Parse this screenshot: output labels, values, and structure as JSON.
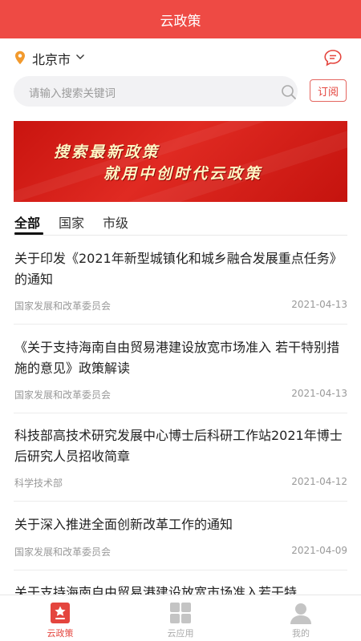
{
  "header": {
    "title": "云政策"
  },
  "location": {
    "city": "北京市"
  },
  "search": {
    "placeholder": "请输入搜索关键词",
    "subscribe_label": "订阅"
  },
  "banner": {
    "line1": "搜索最新政策",
    "line2": "就用中创时代云政策"
  },
  "tabs": [
    {
      "label": "全部",
      "active": true
    },
    {
      "label": "国家",
      "active": false
    },
    {
      "label": "市级",
      "active": false
    }
  ],
  "news": [
    {
      "title": "关于印发《2021年新型城镇化和城乡融合发展重点任务》的通知",
      "source": "国家发展和改革委员会",
      "date": "2021-04-13"
    },
    {
      "title": "《关于支持海南自由贸易港建设放宽市场准入 若干特别措施的意见》政策解读",
      "source": "国家发展和改革委员会",
      "date": "2021-04-13"
    },
    {
      "title": "科技部高技术研究发展中心博士后科研工作站2021年博士后研究人员招收简章",
      "source": "科学技术部",
      "date": "2021-04-12"
    },
    {
      "title": "关于深入推进全面创新改革工作的通知",
      "source": "国家发展和改革委员会",
      "date": "2021-04-09"
    },
    {
      "title": "关于支持海南自由贸易港建设放宽市场准入若干特"
    }
  ],
  "bottom_nav": [
    {
      "label": "云政策",
      "icon": "policy-star-icon",
      "active": true
    },
    {
      "label": "云应用",
      "icon": "apps-grid-icon",
      "active": false
    },
    {
      "label": "我的",
      "icon": "user-icon",
      "active": false
    }
  ],
  "colors": {
    "brand_red": "#ee4a44",
    "accent_red": "#e4453e",
    "muted_text": "#999999"
  }
}
